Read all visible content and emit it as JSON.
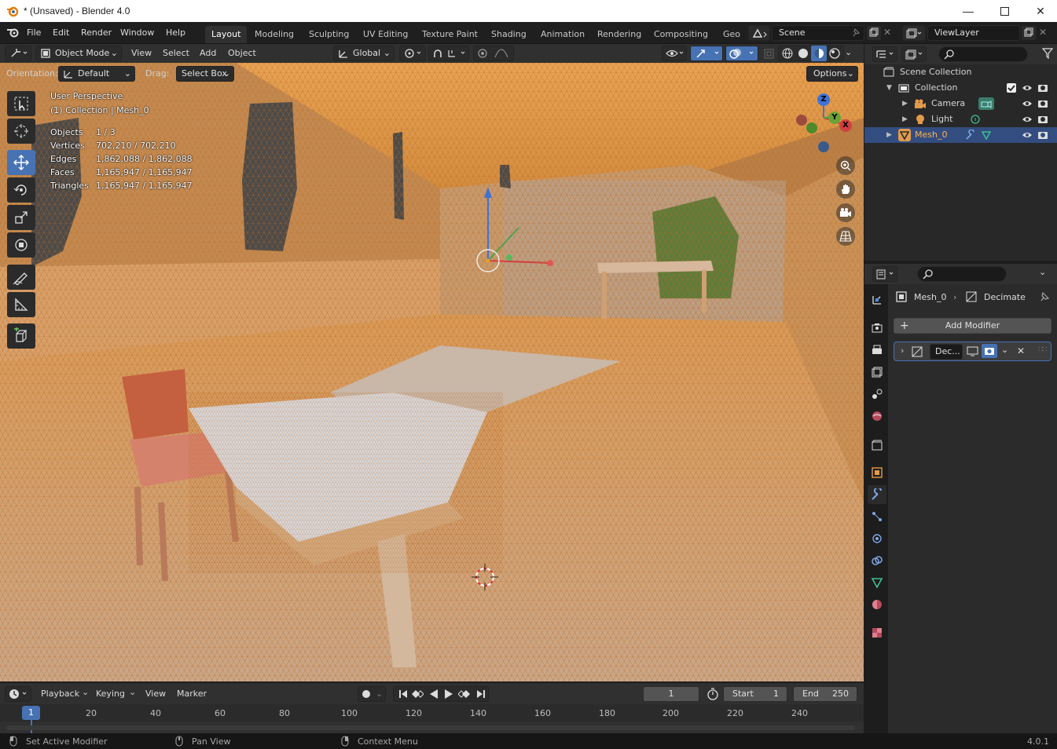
{
  "window": {
    "title": "* (Unsaved) - Blender 4.0"
  },
  "menu": {
    "file": "File",
    "edit": "Edit",
    "render": "Render",
    "window": "Window",
    "help": "Help"
  },
  "workspaces": [
    "Layout",
    "Modeling",
    "Sculpting",
    "UV Editing",
    "Texture Paint",
    "Shading",
    "Animation",
    "Rendering",
    "Compositing",
    "Geo"
  ],
  "scene": {
    "name": "Scene",
    "view_layer": "ViewLayer"
  },
  "header": {
    "mode": "Object Mode",
    "view": "View",
    "select": "Select",
    "add": "Add",
    "object": "Object",
    "transform": "Global"
  },
  "tool_settings": {
    "orientation_label": "Orientation:",
    "orientation_value": "Default",
    "drag_label": "Drag:",
    "drag_value": "Select Box",
    "options": "Options"
  },
  "overlay": {
    "perspective": "User Perspective",
    "collection": "(1) Collection | Mesh_0",
    "stats": [
      {
        "label": "Objects",
        "value": "1 / 3"
      },
      {
        "label": "Vertices",
        "value": "702,210 / 702,210"
      },
      {
        "label": "Edges",
        "value": "1,862,088 / 1,862,088"
      },
      {
        "label": "Faces",
        "value": "1,165,947 / 1,165,947"
      },
      {
        "label": "Triangles",
        "value": "1,165,947 / 1,165,947"
      }
    ]
  },
  "gizmo": {
    "x": "X",
    "y": "Y",
    "z": "Z"
  },
  "outliner": {
    "root": "Scene Collection",
    "collection": "Collection",
    "camera": "Camera",
    "light": "Light",
    "mesh": "Mesh_0"
  },
  "properties": {
    "object": "Mesh_0",
    "modifier": "Decimate",
    "add_modifier": "Add Modifier",
    "modifier_short": "Dec..."
  },
  "timeline": {
    "playback": "Playback",
    "keying": "Keying",
    "view": "View",
    "marker": "Marker",
    "frame": "1",
    "start_label": "Start",
    "start": "1",
    "end_label": "End",
    "end": "250",
    "current": "1",
    "ticks": [
      "20",
      "40",
      "60",
      "80",
      "100",
      "120",
      "140",
      "160",
      "180",
      "200",
      "220",
      "240"
    ]
  },
  "status": {
    "left": "Set Active Modifier",
    "mid": "Pan View",
    "right": "Context Menu",
    "version": "4.0.1"
  },
  "colors": {
    "accent": "#4772b3",
    "selected_row": "#334d80",
    "header": "#303030",
    "mesh_orange": "#e39a4a"
  }
}
